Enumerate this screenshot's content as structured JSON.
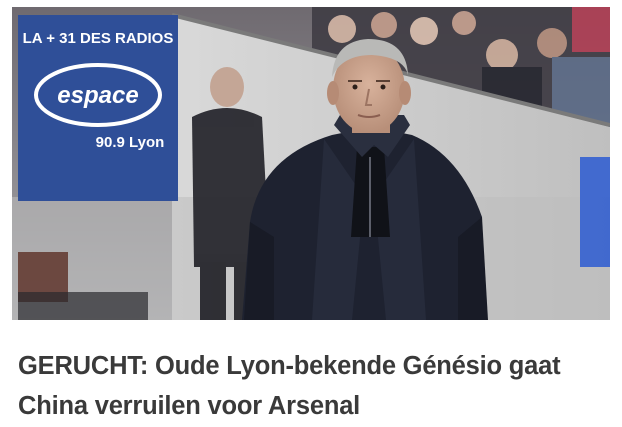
{
  "article": {
    "headline_lines": [
      "GERUCHT: Oude Lyon-bekende Génésio gaat",
      "China verruilen voor Arsenal"
    ]
  },
  "photo": {
    "banner_lines": [
      "LA + 31 DES RADIOS",
      "espace",
      "90.9 Lyon"
    ],
    "palette": {
      "banner": "#2f4f98",
      "stands": "#cfcfcf",
      "coat": "#1e2230",
      "skin": "#c9a48e",
      "hair": "#b9b9b7",
      "text": "#3a3a3a"
    }
  }
}
